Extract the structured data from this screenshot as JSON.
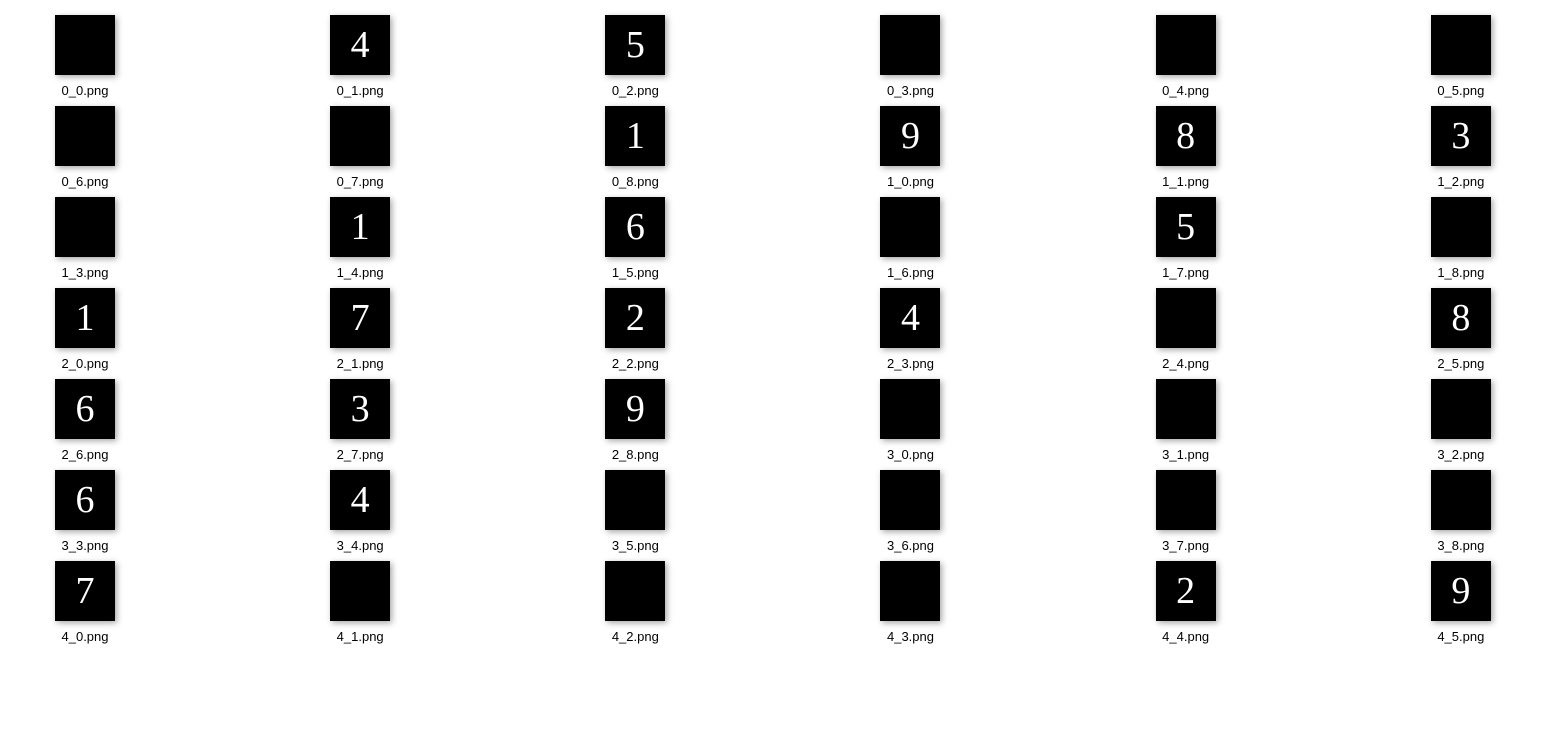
{
  "files": [
    {
      "filename": "0_0.png",
      "digit": ""
    },
    {
      "filename": "0_1.png",
      "digit": "4"
    },
    {
      "filename": "0_2.png",
      "digit": "5"
    },
    {
      "filename": "0_3.png",
      "digit": ""
    },
    {
      "filename": "0_4.png",
      "digit": ""
    },
    {
      "filename": "0_5.png",
      "digit": ""
    },
    {
      "filename": "0_6.png",
      "digit": ""
    },
    {
      "filename": "0_7.png",
      "digit": ""
    },
    {
      "filename": "0_8.png",
      "digit": "1"
    },
    {
      "filename": "1_0.png",
      "digit": "9"
    },
    {
      "filename": "1_1.png",
      "digit": "8"
    },
    {
      "filename": "1_2.png",
      "digit": "3"
    },
    {
      "filename": "1_3.png",
      "digit": ""
    },
    {
      "filename": "1_4.png",
      "digit": "1"
    },
    {
      "filename": "1_5.png",
      "digit": "6"
    },
    {
      "filename": "1_6.png",
      "digit": ""
    },
    {
      "filename": "1_7.png",
      "digit": "5"
    },
    {
      "filename": "1_8.png",
      "digit": ""
    },
    {
      "filename": "2_0.png",
      "digit": "1"
    },
    {
      "filename": "2_1.png",
      "digit": "7"
    },
    {
      "filename": "2_2.png",
      "digit": "2"
    },
    {
      "filename": "2_3.png",
      "digit": "4"
    },
    {
      "filename": "2_4.png",
      "digit": ""
    },
    {
      "filename": "2_5.png",
      "digit": "8"
    },
    {
      "filename": "2_6.png",
      "digit": "6"
    },
    {
      "filename": "2_7.png",
      "digit": "3"
    },
    {
      "filename": "2_8.png",
      "digit": "9"
    },
    {
      "filename": "3_0.png",
      "digit": ""
    },
    {
      "filename": "3_1.png",
      "digit": ""
    },
    {
      "filename": "3_2.png",
      "digit": ""
    },
    {
      "filename": "3_3.png",
      "digit": "6"
    },
    {
      "filename": "3_4.png",
      "digit": "4"
    },
    {
      "filename": "3_5.png",
      "digit": ""
    },
    {
      "filename": "3_6.png",
      "digit": ""
    },
    {
      "filename": "3_7.png",
      "digit": ""
    },
    {
      "filename": "3_8.png",
      "digit": ""
    },
    {
      "filename": "4_0.png",
      "digit": "7"
    },
    {
      "filename": "4_1.png",
      "digit": ""
    },
    {
      "filename": "4_2.png",
      "digit": ""
    },
    {
      "filename": "4_3.png",
      "digit": ""
    },
    {
      "filename": "4_4.png",
      "digit": "2"
    },
    {
      "filename": "4_5.png",
      "digit": "9"
    }
  ]
}
